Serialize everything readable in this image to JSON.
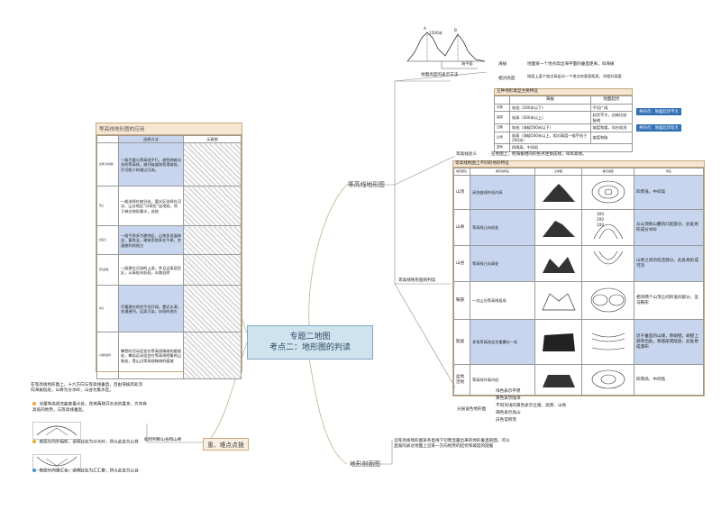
{
  "center": {
    "line1": "专题二地图",
    "line2": "考点二：地形图的判读"
  },
  "branches": {
    "contour": "等高线地形图",
    "profile": "地形剖面图",
    "key": "重、难点点拨"
  },
  "height_repr": {
    "label": "地面高度的表示方法",
    "rows": [
      {
        "term": "海拔",
        "desc": "地面某一个地点高出海平面的垂直距离，叫海拔"
      },
      {
        "term": "相对高度",
        "desc": "地面上某个地点高出另一个地点的垂直距离，叫相对高度"
      }
    ],
    "figure_labels": {
      "a": "1500米",
      "b": "海平面",
      "c": "A",
      "d": "B"
    }
  },
  "landforms": {
    "header": "五种地形类型主要特征",
    "col_a": "海拔",
    "col_b": "地面起伏",
    "rows": [
      {
        "name": "平原",
        "alt": "较低（200米以下）",
        "relief": "平坦广阔"
      },
      {
        "name": "高原",
        "alt": "较高（500米以上）",
        "relief": "起伏不大，边缘比较陡峭"
      },
      {
        "name": "丘陵",
        "alt": "较低（海拔500米以下）",
        "relief": "坡度和缓，沟谷较浅"
      },
      {
        "name": "山地",
        "alt": "较高（海拔500米以上，相对高度一般不低于200米）",
        "relief": "坡度和陡"
      },
      {
        "name": "盆地",
        "alt": "四周高，中间低",
        "relief": ""
      }
    ],
    "note1": "共同点：地面起伏不大",
    "note2": "共同点：地面起伏较大"
  },
  "contour_meaning": {
    "label": "等高线含义",
    "desc": "在地图上，把海拔相同的各点连接成线，叫等高线。"
  },
  "judge": {
    "label": "等高线地形图的判读",
    "header": "等高线地图上不同的地形特征",
    "cols": [
      "地形部位",
      "等高线特征",
      "立体图",
      "等高线图",
      "特征"
    ],
    "rows": [
      {
        "name": "山顶",
        "feature": "闭合曲线外低内高",
        "trait": "四周低，中间高"
      },
      {
        "name": "山脊",
        "feature": "等高线凸向低处",
        "trait": "从山顶到山麓的凸起部分，此处易形成分水岭"
      },
      {
        "name": "山谷",
        "feature": "等高线凸向高处",
        "trait": "山脊之间的低洼部分，此处易形成河流"
      },
      {
        "name": "鞍部",
        "feature": "一对山谷等高线组成",
        "trait": "相邻两个山顶之间的低凹部分，呈马鞍形"
      },
      {
        "name": "陡崖",
        "feature": "多条等高线会合重叠在一处",
        "trait": "近于垂直的山坡，称峭壁。峭壁上部突出处，称悬崖或陡崖，此处易成瀑布"
      },
      {
        "name": "盆地洼地",
        "feature": "等高线外高内低",
        "trait": "四周高、中间低"
      }
    ],
    "contour_nums": [
      "300",
      "200",
      "100"
    ]
  },
  "color_layer": {
    "label": "分层设色地形图",
    "items": [
      "绿色表示平原",
      "黄色表示陆洋",
      "不同深浅的黄色表示丘陵、高原、山地",
      "褐色表示高山",
      "白色常积雪"
    ]
  },
  "profile_desc": "沿等高线地形图某条直线下切而显露出来的地形垂直剖面，可以直观的表达地面上沿某一方向地势的起伏和坡度的陡缓",
  "application": {
    "header": "等高线地形图的应用",
    "col_a": "选择方法",
    "col_b": "示意图",
    "rows": [
      {
        "name": "选择引水线路",
        "text": "一般尽量与等高线平行，避免跨越太多的等高线，避开陡崖和急滑坡处，尽可能少的通过河流。"
      },
      {
        "name": "港口",
        "text": "一般选择在峡谷处，要水区选择在河谷、山谷地区“口袋形”出地处，坝于峡谷地形最水，选地"
      },
      {
        "name": "居民点",
        "text": "一般平原多为耕地区，山地多发展林业，畜牧业，建筑用地多在平原，交通便利的地方"
      },
      {
        "name": "登山路线",
        "text": "一般建在河流的上游，并且远离居民区，从高处向低处，水路自然"
      },
      {
        "name": "水库",
        "text": "尽量建在地势平坦开阔，靠近水源，交通便利，远离污染，向阳的地方"
      },
      {
        "name": "公路线选择",
        "text": "攀登的活动适宜在等高线稀疏的缓坡处，攀岩运动适宜在等高线密集的山坡处，登山沿等高线稀疏的缓坡"
      }
    ]
  },
  "river_label": "如何判断山谷和山脊",
  "river_notes": [
    {
      "text": "在等高线地形图上，十六方向与等高线垂直，且由海拔高处流向海拔低处，山脊为分水岭，山谷为集水区。",
      "color": ""
    },
    {
      "text": "流量等高线弯曲度最大处，在其两侧河水流的最多，方向有高低的地势，与等高线垂直。",
      "color": "#f0a040"
    },
    {
      "text": "若箭头向外辐射，说明此处为分水岭，所以此处为山脊",
      "color": "#e0b020"
    },
    {
      "text": "若箭头向里汇合，说明此处为汇汇聚，所以此处为山谷",
      "color": "#3f8fd0"
    }
  ]
}
